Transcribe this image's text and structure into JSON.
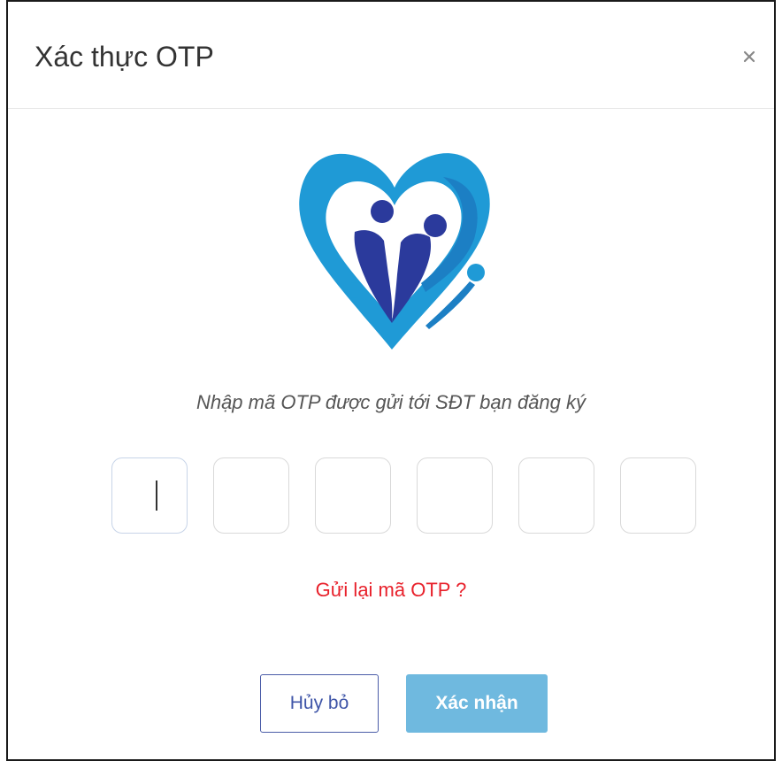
{
  "modal": {
    "title": "Xác thực OTP",
    "close_icon": "close-icon",
    "instruction": "Nhập mã OTP được gửi tới SĐT bạn đăng ký",
    "otp_length": 6,
    "otp_values": [
      "",
      "",
      "",
      "",
      "",
      ""
    ],
    "resend_label": "Gửi lại mã OTP ?",
    "cancel_label": "Hủy bỏ",
    "confirm_label": "Xác nhận"
  },
  "colors": {
    "resend": "#e8212b",
    "cancel_border": "#4a5ca8",
    "confirm_bg": "#6fb9df",
    "logo_light_blue": "#1f9ad6",
    "logo_dark_blue": "#2b3a9c"
  }
}
